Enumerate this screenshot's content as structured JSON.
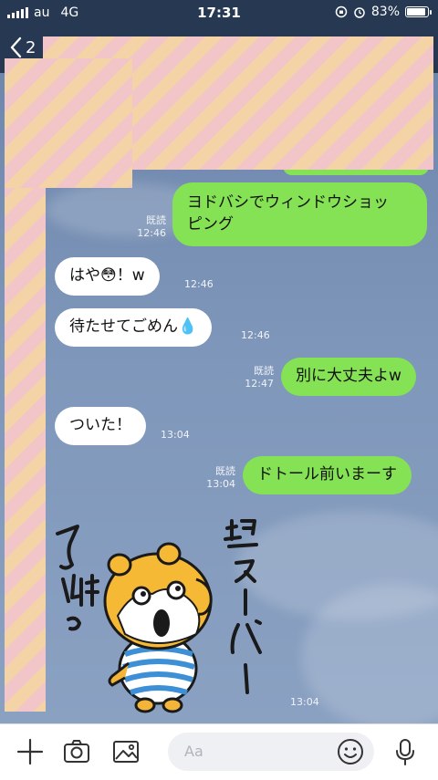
{
  "status_bar": {
    "carrier": "au",
    "network": "4G",
    "time": "17:31",
    "battery": "83%",
    "battery_level": 0.83
  },
  "header": {
    "back_label": "2"
  },
  "messages": [
    {
      "side": "right",
      "text_lines": [
        "ヨドバシでウィンドウショッ",
        "ピング"
      ],
      "read": "既読",
      "time": "12:46"
    },
    {
      "side": "left",
      "text": "はや😳！w",
      "time": "12:46"
    },
    {
      "side": "left",
      "text": "待たせてごめん💧",
      "time": "12:46"
    },
    {
      "side": "right",
      "text": "別に大丈夫よw",
      "read": "既読",
      "time": "12:47"
    },
    {
      "side": "left",
      "text": "ついた！",
      "time": "13:04"
    },
    {
      "side": "right",
      "text": "ドトール前いまーす",
      "read": "既読",
      "time": "13:04"
    }
  ],
  "sticker": {
    "text_left": "了解っ",
    "text_right": "超スーパー",
    "time": "13:04"
  },
  "input": {
    "placeholder": "Aa"
  },
  "icons": [
    "back-chevron-icon",
    "plus-icon",
    "camera-icon",
    "image-icon",
    "emoji-icon",
    "mic-icon",
    "alarm-icon",
    "rotation-lock-icon"
  ],
  "colors": {
    "header_bg": "#263852",
    "my_bubble": "#84e254",
    "their_bubble": "#ffffff"
  }
}
